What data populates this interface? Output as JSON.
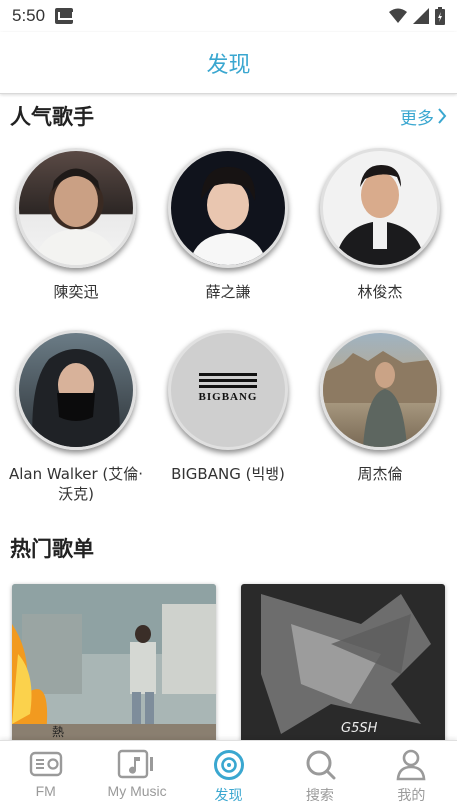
{
  "status_bar": {
    "time": "5:50"
  },
  "header": {
    "title": "发现"
  },
  "popular_artists": {
    "title": "人气歌手",
    "more_label": "更多",
    "artists": [
      {
        "name": "陳奕迅"
      },
      {
        "name": "薛之謙"
      },
      {
        "name": "林俊杰"
      },
      {
        "name": "Alan Walker (艾倫·沃克)"
      },
      {
        "name": "BIGBANG (빅뱅)",
        "logo_text": "BIGBANG"
      },
      {
        "name": "周杰倫"
      }
    ]
  },
  "hot_playlists": {
    "title": "热门歌单",
    "items": [
      {
        "cover_text": "熱"
      },
      {
        "cover_text": "G5SH"
      }
    ]
  },
  "tab_bar": {
    "tabs": [
      {
        "label": "FM",
        "icon": "radio-icon",
        "active": false
      },
      {
        "label": "My Music",
        "icon": "music-note-icon",
        "active": false
      },
      {
        "label": "发现",
        "icon": "disc-icon",
        "active": true
      },
      {
        "label": "搜索",
        "icon": "search-icon",
        "active": false
      },
      {
        "label": "我的",
        "icon": "person-icon",
        "active": false
      }
    ]
  },
  "colors": {
    "accent": "#3aa7d0",
    "inactive": "#9a9a9a"
  }
}
